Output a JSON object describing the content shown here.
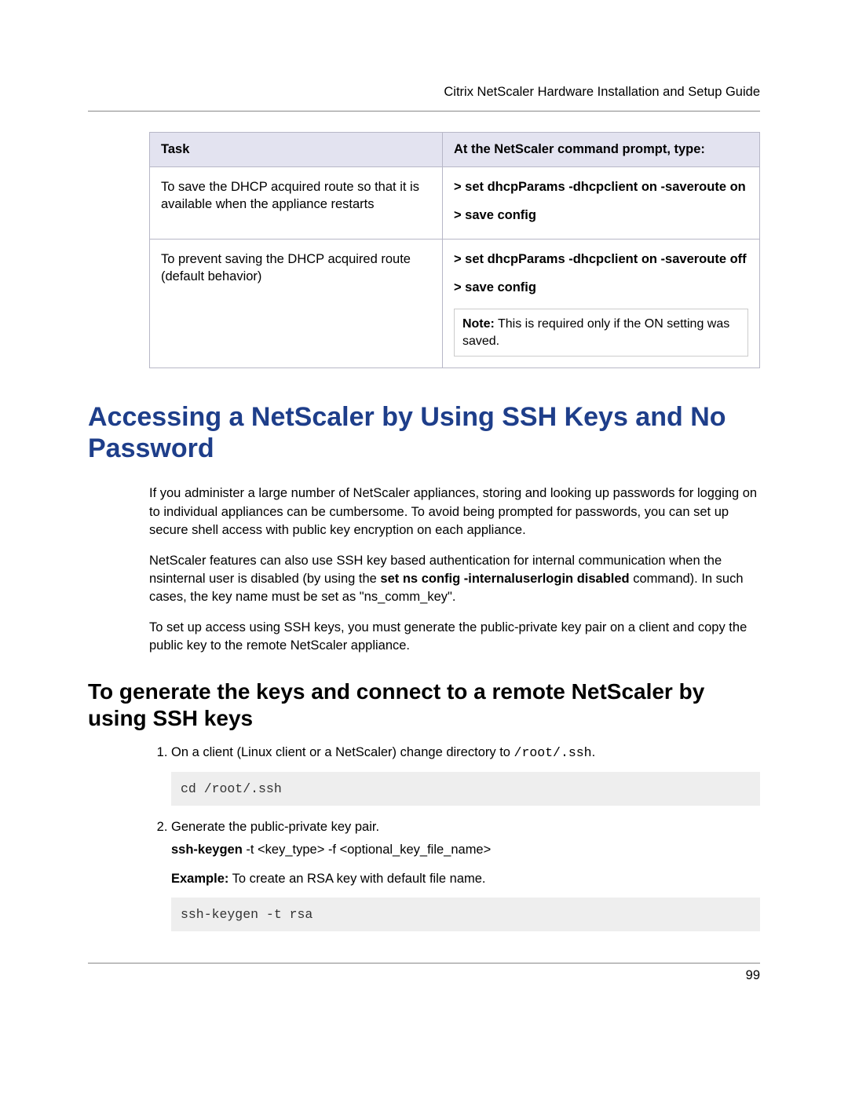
{
  "header": {
    "running_title": "Citrix NetScaler Hardware Installation and Setup Guide"
  },
  "table": {
    "col1_header": "Task",
    "col2_header": "At the NetScaler command prompt, type:",
    "rows": [
      {
        "task": "To save the DHCP acquired route so that it is available when the appliance restarts",
        "cmd1": "> set dhcpParams -dhcpclient on -saveroute on",
        "cmd2": "> save config",
        "note_label": "",
        "note_text": ""
      },
      {
        "task": "To prevent saving the DHCP acquired route (default behavior)",
        "cmd1": "> set dhcpParams -dhcpclient on -saveroute off",
        "cmd2": "> save config",
        "note_label": "Note:",
        "note_text": " This is required only if the ON setting was saved."
      }
    ]
  },
  "section": {
    "title": "Accessing a NetScaler by Using SSH Keys and No Password",
    "para1": "If you administer a large number of NetScaler appliances, storing and looking up passwords for logging on to individual appliances can be cumbersome. To avoid being prompted for passwords, you can set up secure shell access with public key encryption on each appliance.",
    "para2_pre": "NetScaler features can also use SSH key based authentication for internal communication when the nsinternal user is disabled (by using the ",
    "para2_bold": "set ns config -internaluserlogin disabled",
    "para2_post": " command). In such cases, the key name must be set as \"ns_comm_key\".",
    "para3": "To set up access using SSH keys, you must generate the public-private key pair on a client and copy the public key to the remote NetScaler appliance.",
    "subsection_title": "To generate the keys and connect to a remote NetScaler by using SSH keys",
    "step1_pre": "On a client (Linux client or a NetScaler) change directory to ",
    "step1_code": "/root/.ssh",
    "step1_post": ".",
    "code1": "cd /root/.ssh",
    "step2_text": "Generate the public-private key pair.",
    "step2_cmd_bold": "ssh-keygen",
    "step2_cmd_rest": " -t <key_type> -f <optional_key_file_name>",
    "step2_example_label": "Example:",
    "step2_example_text": " To create an RSA key with default file name.",
    "code2": "ssh-keygen -t rsa"
  },
  "footer": {
    "page_number": "99"
  }
}
